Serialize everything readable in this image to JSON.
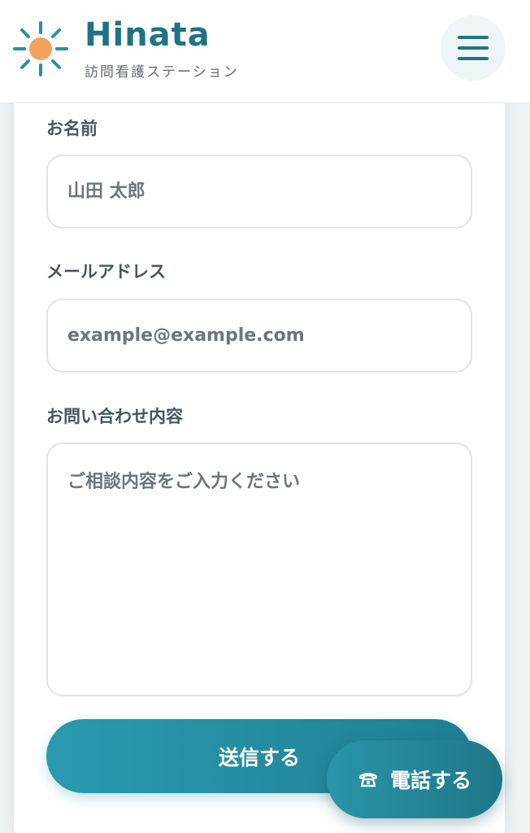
{
  "header": {
    "brand_name": "Hinata",
    "brand_subtitle": "訪問看護ステーション",
    "logo_icon": "sun-icon",
    "menu_icon": "hamburger-menu-icon"
  },
  "form": {
    "name_label": "お名前",
    "name_placeholder": "山田 太郎",
    "email_label": "メールアドレス",
    "email_placeholder": "example@example.com",
    "message_label": "お問い合わせ内容",
    "message_placeholder": "ご相談内容をご入力ください",
    "submit_label": "送信する"
  },
  "floating_call": {
    "label": "電話する",
    "icon": "phone-icon"
  },
  "colors": {
    "brand": "#1d7384",
    "sun": "#f2a25c",
    "button_gradient_start": "#2a9ab0",
    "button_gradient_end": "#1f7f91"
  }
}
